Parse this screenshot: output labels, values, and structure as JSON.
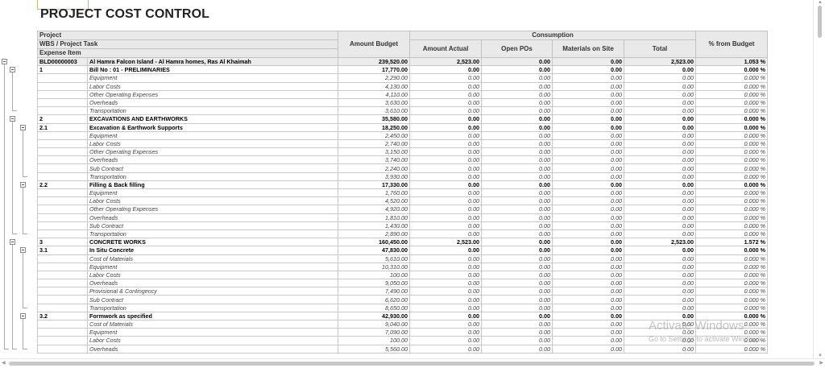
{
  "page": {
    "title": "PROJECT COST CONTROL"
  },
  "header": {
    "project": "Project",
    "wbs": "WBS / Project Task",
    "expense": "Expense Item",
    "amount_budget": "Amount Budget",
    "consumption": "Consumption",
    "amount_actual": "Amount Actual",
    "open_pos": "Open POs",
    "materials_on_site": "Materials on Site",
    "total": "Total",
    "pct_from_budget": "% from Budget"
  },
  "rows": [
    {
      "level": 0,
      "code": "BLD00000003",
      "desc": "Al Hamra Falcon Island - Al Hamra homes, Ras Al Khaimah",
      "budget": "239,520.00",
      "actual": "2,523.00",
      "open": "0.00",
      "mat": "0.00",
      "total": "2,523.00",
      "pct": "1.053 %"
    },
    {
      "level": 1,
      "code": "1",
      "desc": "Bill No : 01 - PRELIMINARIES",
      "budget": "17,770.00",
      "actual": "0.00",
      "open": "0.00",
      "mat": "0.00",
      "total": "0.00",
      "pct": "0.000 %"
    },
    {
      "level": 3,
      "code": "",
      "desc": "Equipment",
      "budget": "2,290.00",
      "actual": "0.00",
      "open": "0.00",
      "mat": "0.00",
      "total": "0.00",
      "pct": "0.000 %"
    },
    {
      "level": 3,
      "code": "",
      "desc": "Labor Costs",
      "budget": "4,130.00",
      "actual": "0.00",
      "open": "0.00",
      "mat": "0.00",
      "total": "0.00",
      "pct": "0.000 %"
    },
    {
      "level": 3,
      "code": "",
      "desc": "Other Operating Expenses",
      "budget": "4,110.00",
      "actual": "0.00",
      "open": "0.00",
      "mat": "0.00",
      "total": "0.00",
      "pct": "0.000 %"
    },
    {
      "level": 3,
      "code": "",
      "desc": "Overheads",
      "budget": "3,630.00",
      "actual": "0.00",
      "open": "0.00",
      "mat": "0.00",
      "total": "0.00",
      "pct": "0.000 %"
    },
    {
      "level": 3,
      "code": "",
      "desc": "Transportation",
      "budget": "3,610.00",
      "actual": "0.00",
      "open": "0.00",
      "mat": "0.00",
      "total": "0.00",
      "pct": "0.000 %"
    },
    {
      "level": 1,
      "code": "2",
      "desc": "EXCAVATIONS AND EARTHWORKS",
      "budget": "35,580.00",
      "actual": "0.00",
      "open": "0.00",
      "mat": "0.00",
      "total": "0.00",
      "pct": "0.000 %"
    },
    {
      "level": 2,
      "code": "2.1",
      "desc": "Excavation & Earthwork Supports",
      "budget": "18,250.00",
      "actual": "0.00",
      "open": "0.00",
      "mat": "0.00",
      "total": "0.00",
      "pct": "0.000 %"
    },
    {
      "level": 3,
      "code": "",
      "desc": "Equipment",
      "budget": "2,450.00",
      "actual": "0.00",
      "open": "0.00",
      "mat": "0.00",
      "total": "0.00",
      "pct": "0.000 %"
    },
    {
      "level": 3,
      "code": "",
      "desc": "Labor Costs",
      "budget": "2,740.00",
      "actual": "0.00",
      "open": "0.00",
      "mat": "0.00",
      "total": "0.00",
      "pct": "0.000 %"
    },
    {
      "level": 3,
      "code": "",
      "desc": "Other Operating Expenses",
      "budget": "3,150.00",
      "actual": "0.00",
      "open": "0.00",
      "mat": "0.00",
      "total": "0.00",
      "pct": "0.000 %"
    },
    {
      "level": 3,
      "code": "",
      "desc": "Overheads",
      "budget": "3,740.00",
      "actual": "0.00",
      "open": "0.00",
      "mat": "0.00",
      "total": "0.00",
      "pct": "0.000 %"
    },
    {
      "level": 3,
      "code": "",
      "desc": "Sub Contract",
      "budget": "2,240.00",
      "actual": "0.00",
      "open": "0.00",
      "mat": "0.00",
      "total": "0.00",
      "pct": "0.000 %"
    },
    {
      "level": 3,
      "code": "",
      "desc": "Transportation",
      "budget": "3,930.00",
      "actual": "0.00",
      "open": "0.00",
      "mat": "0.00",
      "total": "0.00",
      "pct": "0.000 %"
    },
    {
      "level": 2,
      "code": "2.2",
      "desc": "Filling & Back filling",
      "budget": "17,330.00",
      "actual": "0.00",
      "open": "0.00",
      "mat": "0.00",
      "total": "0.00",
      "pct": "0.000 %"
    },
    {
      "level": 3,
      "code": "",
      "desc": "Equipment",
      "budget": "1,760.00",
      "actual": "0.00",
      "open": "0.00",
      "mat": "0.00",
      "total": "0.00",
      "pct": "0.000 %"
    },
    {
      "level": 3,
      "code": "",
      "desc": "Labor Costs",
      "budget": "4,520.00",
      "actual": "0.00",
      "open": "0.00",
      "mat": "0.00",
      "total": "0.00",
      "pct": "0.000 %"
    },
    {
      "level": 3,
      "code": "",
      "desc": "Other Operating Expenses",
      "budget": "4,920.00",
      "actual": "0.00",
      "open": "0.00",
      "mat": "0.00",
      "total": "0.00",
      "pct": "0.000 %"
    },
    {
      "level": 3,
      "code": "",
      "desc": "Overheads",
      "budget": "1,810.00",
      "actual": "0.00",
      "open": "0.00",
      "mat": "0.00",
      "total": "0.00",
      "pct": "0.000 %"
    },
    {
      "level": 3,
      "code": "",
      "desc": "Sub Contract",
      "budget": "1,430.00",
      "actual": "0.00",
      "open": "0.00",
      "mat": "0.00",
      "total": "0.00",
      "pct": "0.000 %"
    },
    {
      "level": 3,
      "code": "",
      "desc": "Transportation",
      "budget": "2,890.00",
      "actual": "0.00",
      "open": "0.00",
      "mat": "0.00",
      "total": "0.00",
      "pct": "0.000 %"
    },
    {
      "level": 1,
      "code": "3",
      "desc": "CONCRETE WORKS",
      "budget": "160,450.00",
      "actual": "2,523.00",
      "open": "0.00",
      "mat": "0.00",
      "total": "2,523.00",
      "pct": "1.572 %"
    },
    {
      "level": 2,
      "code": "3.1",
      "desc": "In Situ Concrete",
      "budget": "47,830.00",
      "actual": "0.00",
      "open": "0.00",
      "mat": "0.00",
      "total": "0.00",
      "pct": "0.000 %"
    },
    {
      "level": 3,
      "code": "",
      "desc": "Cost of Materials",
      "budget": "5,610.00",
      "actual": "0.00",
      "open": "0.00",
      "mat": "0.00",
      "total": "0.00",
      "pct": "0.000 %"
    },
    {
      "level": 3,
      "code": "",
      "desc": "Equipment",
      "budget": "10,310.00",
      "actual": "0.00",
      "open": "0.00",
      "mat": "0.00",
      "total": "0.00",
      "pct": "0.000 %"
    },
    {
      "level": 3,
      "code": "",
      "desc": "Labor Costs",
      "budget": "100.00",
      "actual": "0.00",
      "open": "0.00",
      "mat": "0.00",
      "total": "0.00",
      "pct": "0.000 %"
    },
    {
      "level": 3,
      "code": "",
      "desc": "Overheads",
      "budget": "9,050.00",
      "actual": "0.00",
      "open": "0.00",
      "mat": "0.00",
      "total": "0.00",
      "pct": "0.000 %"
    },
    {
      "level": 3,
      "code": "",
      "desc": "Provisional & Contingency",
      "budget": "7,490.00",
      "actual": "0.00",
      "open": "0.00",
      "mat": "0.00",
      "total": "0.00",
      "pct": "0.000 %"
    },
    {
      "level": 3,
      "code": "",
      "desc": "Sub Contract",
      "budget": "6,620.00",
      "actual": "0.00",
      "open": "0.00",
      "mat": "0.00",
      "total": "0.00",
      "pct": "0.000 %"
    },
    {
      "level": 3,
      "code": "",
      "desc": "Transportation",
      "budget": "8,650.00",
      "actual": "0.00",
      "open": "0.00",
      "mat": "0.00",
      "total": "0.00",
      "pct": "0.000 %"
    },
    {
      "level": 2,
      "code": "3.2",
      "desc": "Formwork as specified",
      "budget": "42,930.00",
      "actual": "0.00",
      "open": "0.00",
      "mat": "0.00",
      "total": "0.00",
      "pct": "0.000 %"
    },
    {
      "level": 3,
      "code": "",
      "desc": "Cost of Materials",
      "budget": "9,040.00",
      "actual": "0.00",
      "open": "0.00",
      "mat": "0.00",
      "total": "0.00",
      "pct": "0.000 %"
    },
    {
      "level": 3,
      "code": "",
      "desc": "Equipment",
      "budget": "7,090.00",
      "actual": "0.00",
      "open": "0.00",
      "mat": "0.00",
      "total": "0.00",
      "pct": "0.000 %"
    },
    {
      "level": 3,
      "code": "",
      "desc": "Labor Costs",
      "budget": "100.00",
      "actual": "0.00",
      "open": "0.00",
      "mat": "0.00",
      "total": "0.00",
      "pct": "0.000 %"
    },
    {
      "level": 3,
      "code": "",
      "desc": "Overheads",
      "budget": "5,560.00",
      "actual": "0.00",
      "open": "0.00",
      "mat": "0.00",
      "total": "0.00",
      "pct": "0.000 %"
    }
  ],
  "watermark": {
    "line1": "Activate Windows",
    "line2": "Go to Settings to activate Windows."
  }
}
